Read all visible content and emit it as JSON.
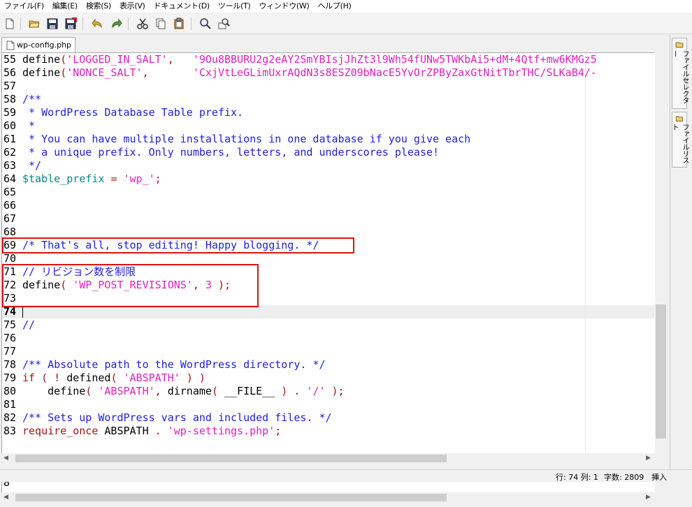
{
  "menu": [
    "ファイル(F)",
    "編集(E)",
    "検索(S)",
    "表示(V)",
    "ドキュメント(D)",
    "ツール(T)",
    "ウィンドウ(W)",
    "ヘルプ(H)"
  ],
  "toolbar": {
    "icons": [
      "new-file-icon",
      "open-folder-icon",
      "save-icon",
      "save-all-icon",
      "undo-icon",
      "redo-icon",
      "cut-icon",
      "copy-icon",
      "paste-icon",
      "search-icon",
      "replace-icon"
    ]
  },
  "tab": {
    "label": "wp-config.php"
  },
  "editor": {
    "current_line": 74,
    "lines": [
      {
        "num": "55",
        "tokens": [
          [
            "",
            "define"
          ],
          [
            "punc",
            "("
          ],
          [
            "str",
            "'LOGGED_IN_SALT'"
          ],
          [
            "punc",
            ","
          ],
          [
            "",
            "   "
          ],
          [
            "str",
            "'9Ou8BBURU2g2eAY2SmYBIsjJhZt3l9Wh54fUNw5TWKbAi5+dM+4Qtf+mw6KMGz5"
          ]
        ]
      },
      {
        "num": "56",
        "tokens": [
          [
            "",
            "define"
          ],
          [
            "punc",
            "("
          ],
          [
            "str",
            "'NONCE_SALT'"
          ],
          [
            "punc",
            ","
          ],
          [
            "",
            "       "
          ],
          [
            "str",
            "'CxjVtLeGLimUxrAQdN3s8ESZ09bNacE5YvOrZPByZaxGtNitTbrTHC/SLKaB4/-"
          ]
        ]
      },
      {
        "num": "57",
        "tokens": []
      },
      {
        "num": "58",
        "tokens": [
          [
            "cmt",
            "/**"
          ]
        ]
      },
      {
        "num": "59",
        "tokens": [
          [
            "cmt",
            " * WordPress Database Table prefix."
          ]
        ]
      },
      {
        "num": "60",
        "tokens": [
          [
            "cmt",
            " *"
          ]
        ]
      },
      {
        "num": "61",
        "tokens": [
          [
            "cmt",
            " * You can have multiple installations in one database if you give each"
          ]
        ]
      },
      {
        "num": "62",
        "tokens": [
          [
            "cmt",
            " * a unique prefix. Only numbers, letters, and underscores please!"
          ]
        ]
      },
      {
        "num": "63",
        "tokens": [
          [
            "cmt",
            " */"
          ]
        ]
      },
      {
        "num": "64",
        "tokens": [
          [
            "var",
            "$table_prefix"
          ],
          [
            "",
            " "
          ],
          [
            "punc",
            "="
          ],
          [
            "",
            " "
          ],
          [
            "str",
            "'wp_'"
          ],
          [
            "punc",
            ";"
          ]
        ]
      },
      {
        "num": "65",
        "tokens": []
      },
      {
        "num": "66",
        "tokens": []
      },
      {
        "num": "67",
        "tokens": []
      },
      {
        "num": "68",
        "tokens": []
      },
      {
        "num": "69",
        "tokens": [
          [
            "cmt",
            "/* That's all, stop editing! Happy blogging. */"
          ]
        ]
      },
      {
        "num": "70",
        "tokens": []
      },
      {
        "num": "71",
        "tokens": [
          [
            "cmt",
            "// リビジョン数を制限"
          ]
        ]
      },
      {
        "num": "72",
        "tokens": [
          [
            "",
            "define"
          ],
          [
            "punc",
            "("
          ],
          [
            "",
            " "
          ],
          [
            "str",
            "'WP_POST_REVISIONS'"
          ],
          [
            "punc",
            ","
          ],
          [
            "",
            " "
          ],
          [
            "str",
            "3"
          ],
          [
            "",
            " "
          ],
          [
            "punc",
            ");"
          ]
        ]
      },
      {
        "num": "73",
        "tokens": []
      },
      {
        "num": "74",
        "tokens": []
      },
      {
        "num": "75",
        "tokens": [
          [
            "cmt",
            "//"
          ]
        ]
      },
      {
        "num": "76",
        "tokens": []
      },
      {
        "num": "77",
        "tokens": []
      },
      {
        "num": "78",
        "tokens": [
          [
            "cmt",
            "/** Absolute path to the WordPress directory. */"
          ]
        ]
      },
      {
        "num": "79",
        "tokens": [
          [
            "kw",
            "if"
          ],
          [
            "",
            " "
          ],
          [
            "punc",
            "("
          ],
          [
            "",
            " "
          ],
          [
            "punc",
            "!"
          ],
          [
            "",
            " defined"
          ],
          [
            "punc",
            "("
          ],
          [
            "",
            " "
          ],
          [
            "str",
            "'ABSPATH'"
          ],
          [
            "",
            " "
          ],
          [
            "punc",
            ")"
          ],
          [
            "",
            " "
          ],
          [
            "punc",
            ")"
          ]
        ]
      },
      {
        "num": "80",
        "tokens": [
          [
            "",
            "    define"
          ],
          [
            "punc",
            "("
          ],
          [
            "",
            " "
          ],
          [
            "str",
            "'ABSPATH'"
          ],
          [
            "punc",
            ","
          ],
          [
            "",
            " dirname"
          ],
          [
            "punc",
            "("
          ],
          [
            "",
            " __FILE__ "
          ],
          [
            "punc",
            ")"
          ],
          [
            "",
            " "
          ],
          [
            "punc",
            "."
          ],
          [
            "",
            " "
          ],
          [
            "str",
            "'/'"
          ],
          [
            "",
            " "
          ],
          [
            "punc",
            ");"
          ]
        ]
      },
      {
        "num": "81",
        "tokens": []
      },
      {
        "num": "82",
        "tokens": [
          [
            "cmt",
            "/** Sets up WordPress vars and included files. */"
          ]
        ]
      },
      {
        "num": "83",
        "tokens": [
          [
            "kw",
            "require_once"
          ],
          [
            "",
            " ABSPATH "
          ],
          [
            "punc",
            "."
          ],
          [
            "",
            " "
          ],
          [
            "str",
            "'wp-settings.php'"
          ],
          [
            "punc",
            ";"
          ]
        ]
      }
    ]
  },
  "side_panel": {
    "tabs": [
      "ファイルセレクター",
      "ファイルリスト"
    ]
  },
  "status": {
    "position": "行: 74 列: 1",
    "chars": "字数: 2809",
    "mode": "挿入"
  },
  "lower_pane": {
    "text": "8"
  }
}
